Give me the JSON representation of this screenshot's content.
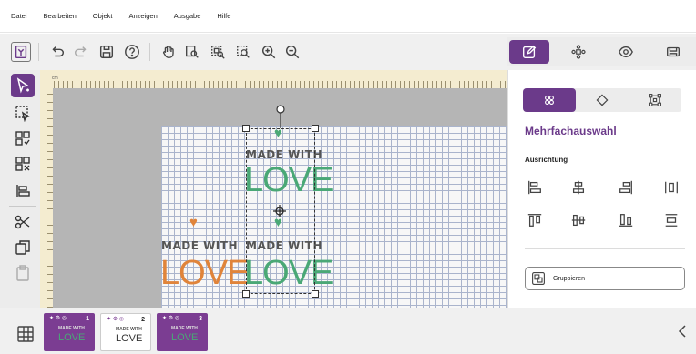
{
  "menu": {
    "items": [
      "Datei",
      "Bearbeiten",
      "Objekt",
      "Anzeigen",
      "Ausgabe",
      "Hilfe"
    ]
  },
  "toolbar": {
    "icons": [
      "app-icon",
      "undo-icon",
      "redo-icon",
      "save-icon",
      "help-icon",
      "hand-icon",
      "zoom-page-icon",
      "zoom-selection-icon",
      "zoom-area-icon",
      "zoom-in-icon",
      "zoom-out-icon"
    ]
  },
  "right_tabs": {
    "icons": [
      "edit-icon",
      "scatter-icon",
      "preview-icon",
      "cut-output-icon"
    ],
    "active": "edit-icon"
  },
  "left_tools": {
    "icons": [
      "select-icon",
      "node-select-icon",
      "group-icon",
      "ungroup-icon",
      "align-icon",
      "scissors-icon",
      "copy-icon",
      "paste-icon"
    ],
    "active": "select-icon"
  },
  "canvas": {
    "ruler_unit": "cm",
    "designs": [
      {
        "line1": "MADE WITH",
        "line2": "LOVE",
        "color": "#4aa876",
        "heart_color": "#4aa876"
      },
      {
        "line1": "MADE WITH",
        "line2": "LOVE",
        "color": "#e0843a",
        "heart_color": "#e0843a"
      },
      {
        "line1": "MADE WITH",
        "line2": "LOVE",
        "color": "#4aa876",
        "heart_color": "#4aa876"
      }
    ]
  },
  "panel": {
    "tabs": [
      "multi-select-icon",
      "vertex-icon",
      "transform-icon"
    ],
    "title": "Mehrfachauswahl",
    "section_align": "Ausrichtung",
    "align_buttons": [
      "align-left-icon",
      "align-center-h-icon",
      "align-right-icon",
      "distribute-h-icon",
      "align-top-icon",
      "align-center-v-icon",
      "align-bottom-icon",
      "distribute-v-icon"
    ],
    "group_label": "Gruppieren"
  },
  "pages": [
    {
      "number": "1",
      "selected": true,
      "line1": "MADE WITH",
      "line2": "LOVE"
    },
    {
      "number": "2",
      "selected": false,
      "line1": "MADE WITH",
      "line2": "LOVE"
    },
    {
      "number": "3",
      "selected": true,
      "line1": "MADE WITH",
      "line2": "LOVE"
    }
  ],
  "colors": {
    "accent": "#6b3a8a",
    "love_green": "#4aa876",
    "love_orange": "#e0843a"
  }
}
